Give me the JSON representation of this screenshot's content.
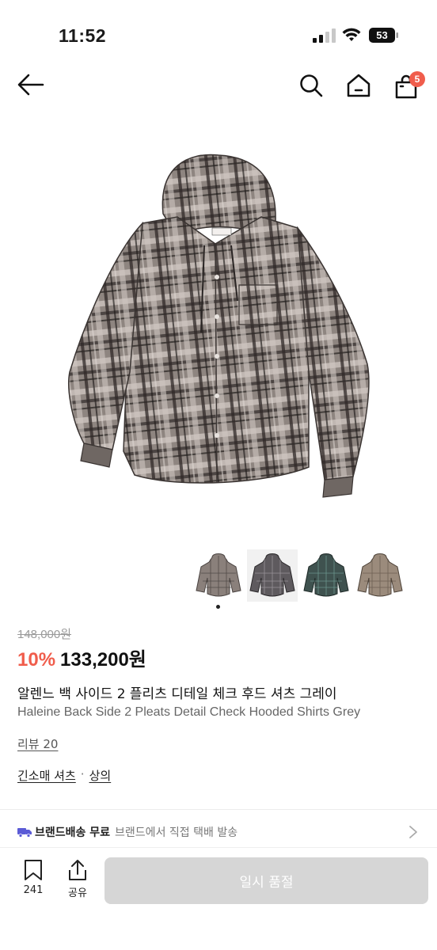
{
  "status_bar": {
    "time": "11:52",
    "battery_level": "53"
  },
  "nav": {
    "cart_count": "5"
  },
  "thumbnails": [
    {
      "name": "thumb-grey"
    },
    {
      "name": "thumb-dark-grey"
    },
    {
      "name": "thumb-green"
    },
    {
      "name": "thumb-brown"
    }
  ],
  "product": {
    "original_price": "148,000원",
    "discount": "10%",
    "sale_price": "133,200원",
    "title_ko": "알렌느 백 사이드 2 플리츠 디테일 체크 후드 셔츠 그레이",
    "title_en": "Haleine Back Side 2 Pleats Detail Check Hooded Shirts Grey",
    "review": "리뷰 20",
    "category_1": "긴소매 셔츠",
    "category_sep": "·",
    "category_2": "상의"
  },
  "shipping": {
    "label": "브랜드배송 무료",
    "desc": "브랜드에서 직접 택배 발송"
  },
  "bottom_bar": {
    "bookmark_count": "241",
    "share_label": "공유",
    "soldout_label": "일시 품절"
  },
  "colors": {
    "accent": "#f05d4c",
    "disabled_button": "#d6d6d6",
    "shipping_icon": "#5b5bd6"
  }
}
